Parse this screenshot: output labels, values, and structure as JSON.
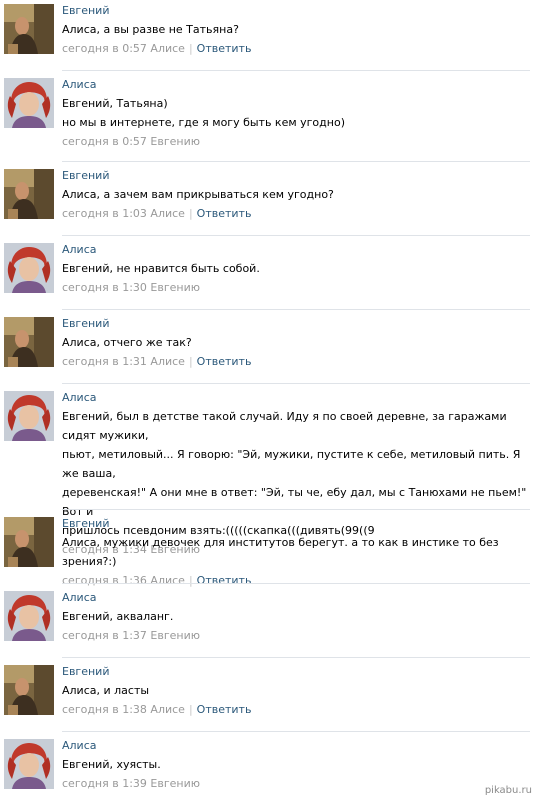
{
  "posts": [
    {
      "author": "Евгений",
      "avatar": "evgeny",
      "lines": [
        "Алиса, а вы разве не Татьяна?"
      ],
      "time": "сегодня в 0:57",
      "reply_to": "Алисе",
      "reply": "Ответить"
    },
    {
      "author": "Алиса",
      "avatar": "alisa",
      "lines": [
        "Евгений, Татьяна)",
        "но мы в интернете, где я могу быть кем угодно)"
      ],
      "time": "сегодня в 0:57",
      "reply_to": "Евгению",
      "reply": ""
    },
    {
      "author": "Евгений",
      "avatar": "evgeny",
      "lines": [
        "Алиса, а зачем вам прикрываться кем угодно?"
      ],
      "time": "сегодня в 1:03",
      "reply_to": "Алисе",
      "reply": "Ответить"
    },
    {
      "author": "Алиса",
      "avatar": "alisa",
      "lines": [
        "Евгений, не нравится быть собой."
      ],
      "time": "сегодня в 1:30",
      "reply_to": "Евгению",
      "reply": ""
    },
    {
      "author": "Евгений",
      "avatar": "evgeny",
      "lines": [
        "Алиса, отчего же так?"
      ],
      "time": "сегодня в 1:31",
      "reply_to": "Алисе",
      "reply": "Ответить"
    },
    {
      "author": "Алиса",
      "avatar": "alisa",
      "lines": [
        "Евгений, был в детстве такой случай. Иду я по своей деревне, за гаражами сидят мужики,",
        "пьют, метиловый... Я говорю: \"Эй, мужики, пустите к себе, метиловый пить. Я же ваша,",
        "деревенская!\" А они мне в ответ: \"Эй, ты че, ебу дал, мы с Танюхами не пьем!\" Вот и",
        "пришлось псевдоним взять:(((((скапка(((дивять(99((9"
      ],
      "time": "сегодня в 1:34",
      "reply_to": "Евгению",
      "reply": ""
    },
    {
      "author": "Евгений",
      "avatar": "evgeny",
      "lines": [
        "Алиса, мужики девочек для институтов берегут. а то как в инстике то без зрения?:)"
      ],
      "time": "сегодня в 1:36",
      "reply_to": "Алисе",
      "reply": "Ответить"
    },
    {
      "author": "Алиса",
      "avatar": "alisa",
      "lines": [
        "Евгений, акваланг."
      ],
      "time": "сегодня в 1:37",
      "reply_to": "Евгению",
      "reply": ""
    },
    {
      "author": "Евгений",
      "avatar": "evgeny",
      "lines": [
        "Алиса, и ласты"
      ],
      "time": "сегодня в 1:38",
      "reply_to": "Алисе",
      "reply": "Ответить"
    },
    {
      "author": "Алиса",
      "avatar": "alisa",
      "lines": [
        "Евгений, хуясты."
      ],
      "time": "сегодня в 1:39",
      "reply_to": "Евгению",
      "reply": ""
    }
  ],
  "watermark": "pikabu.ru",
  "colors": {
    "author": "#2b587a",
    "meta": "#999999",
    "divider": "#dfe3e8"
  }
}
